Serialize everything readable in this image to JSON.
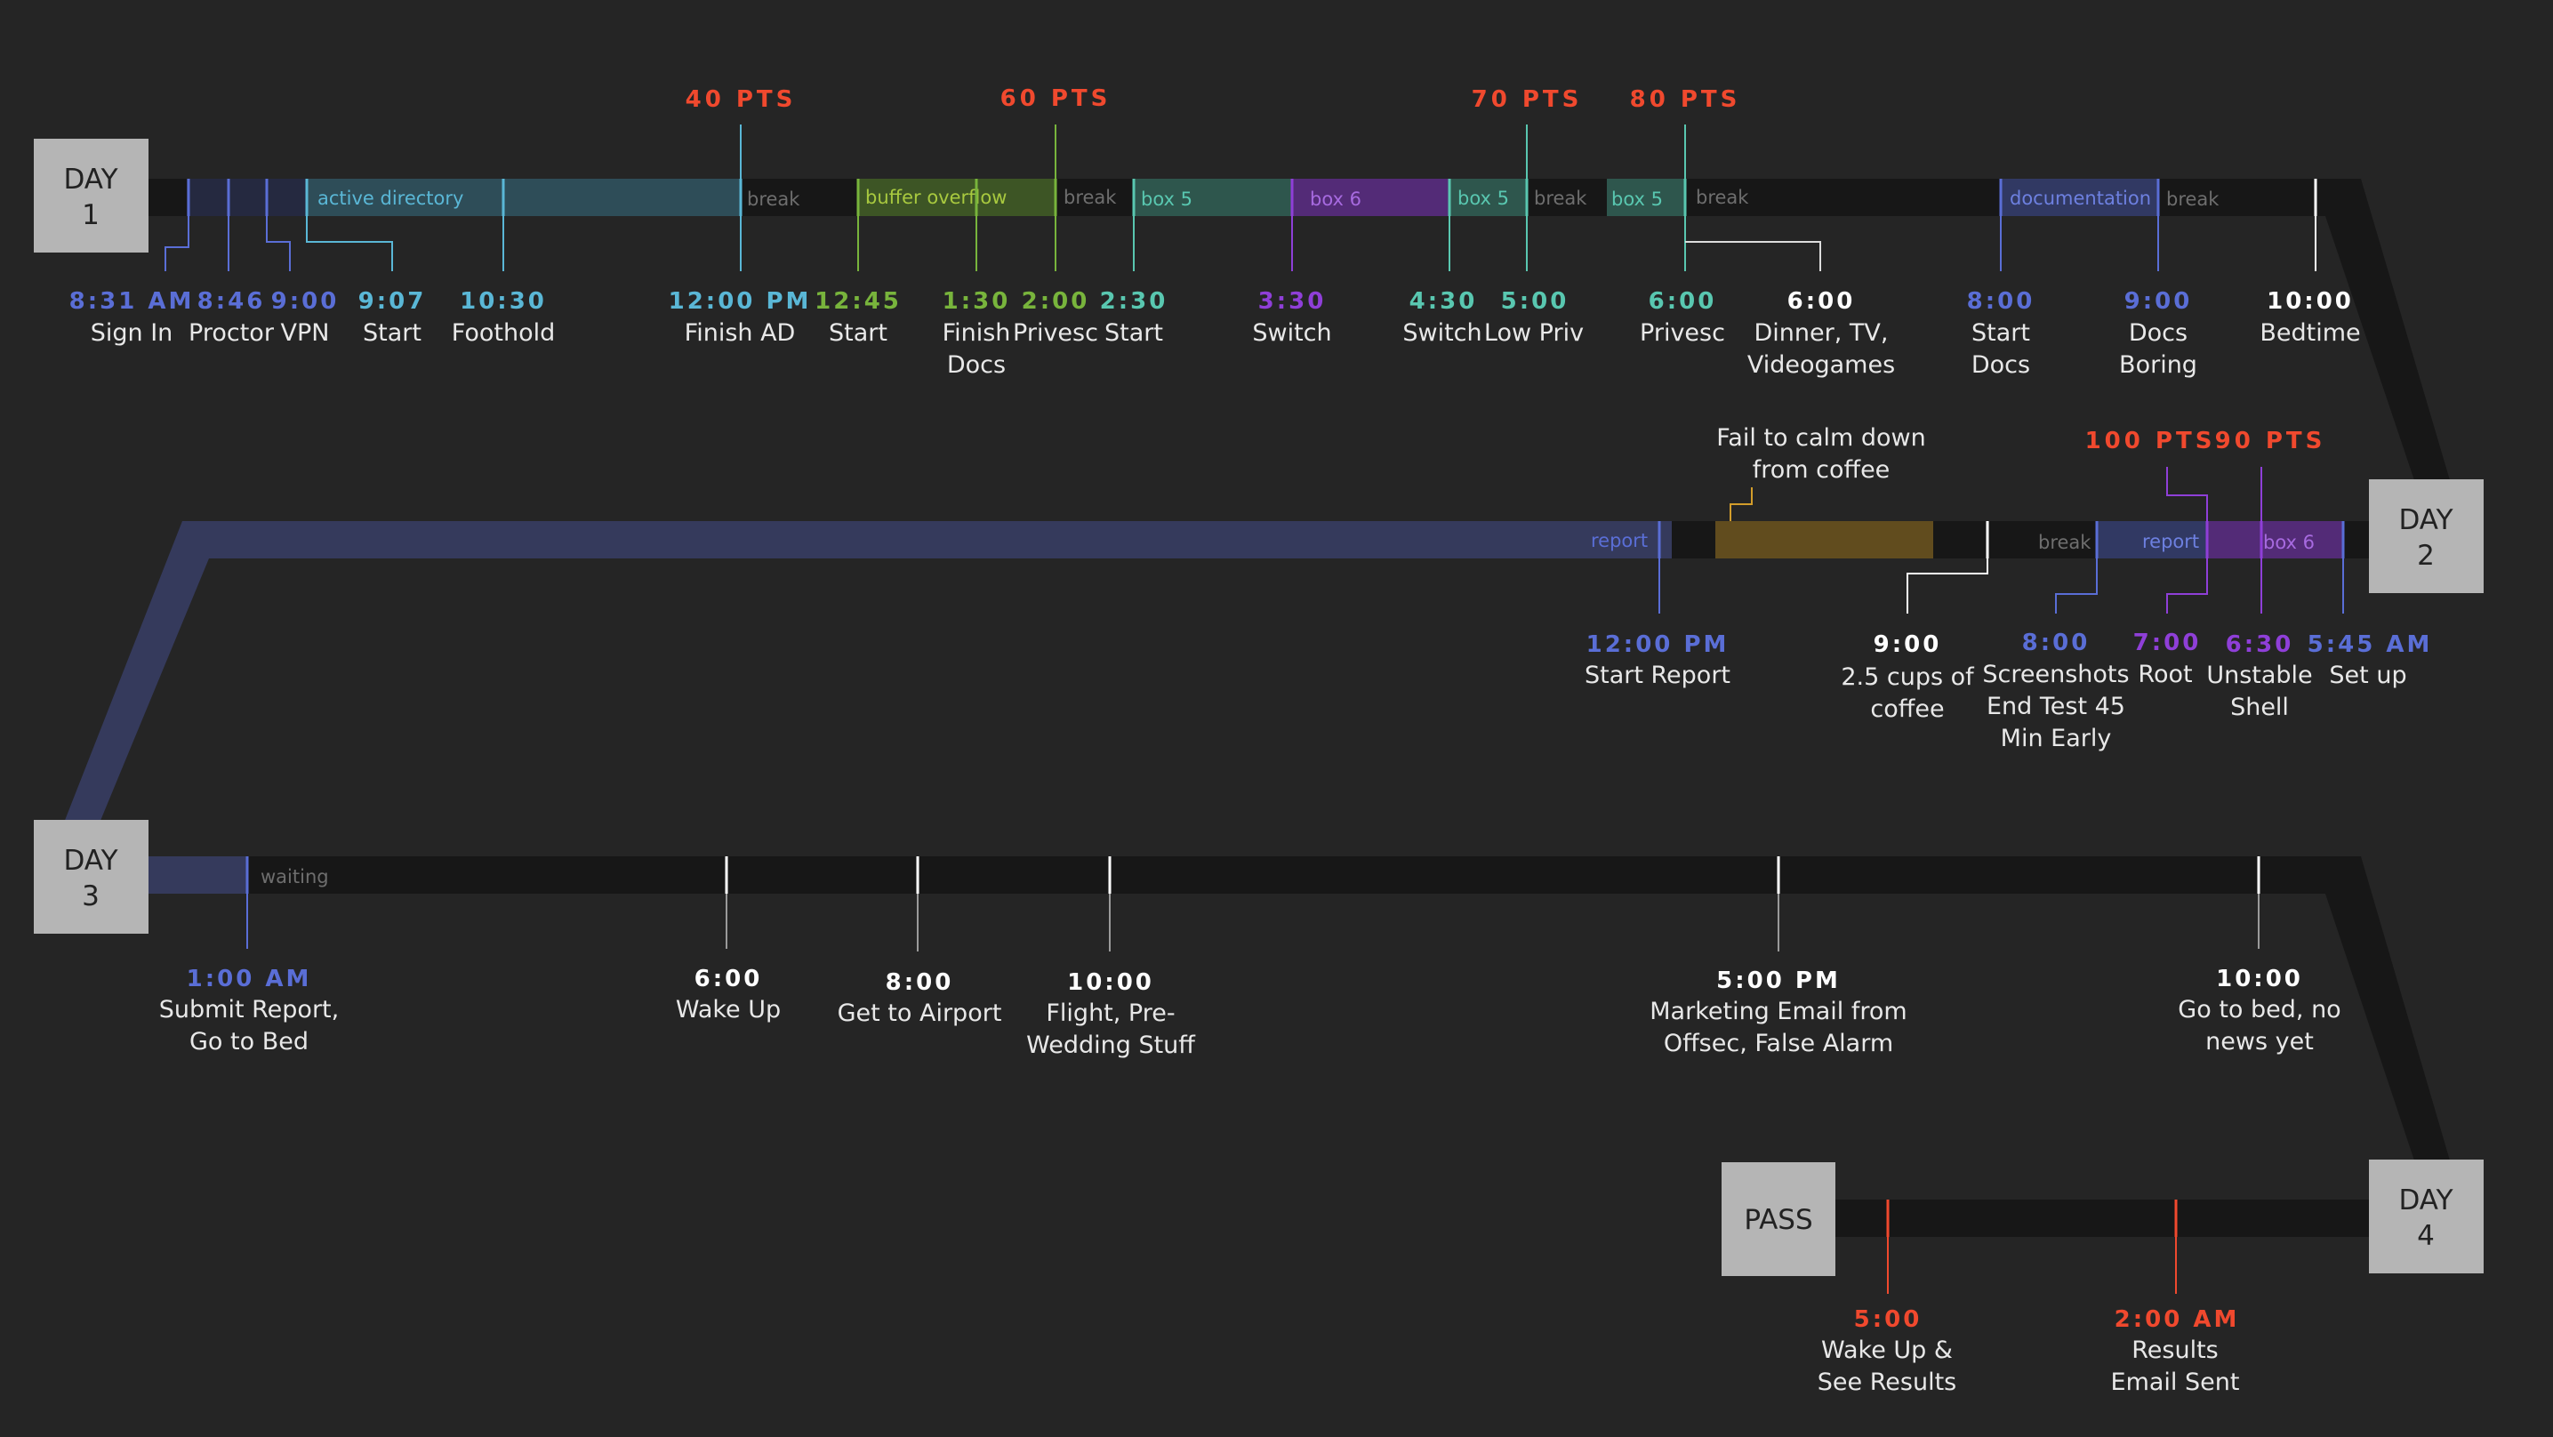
{
  "colors": {
    "background": "#252525",
    "track": "#171717",
    "day_box": "#b5b5b5",
    "cyan": "#5ab7d6",
    "blue": "#5a6ed6",
    "green": "#78b43c",
    "teal": "#59c7b0",
    "purple": "#8f3fd8",
    "red": "#f0492e",
    "white": "#ffffff",
    "gold": "#d39d2b",
    "gray_text": "#6e6e6e"
  },
  "days": [
    {
      "id": "d1",
      "line1": "DAY",
      "line2": "1"
    },
    {
      "id": "d2",
      "line1": "DAY",
      "line2": "2"
    },
    {
      "id": "d3",
      "line1": "DAY",
      "line2": "3"
    },
    {
      "id": "d4",
      "line1": "DAY",
      "line2": "4"
    }
  ],
  "pass_label": "PASS",
  "segments": [
    {
      "id": "s1",
      "label": "active directory",
      "color": "cyan"
    },
    {
      "id": "s2",
      "label": "break",
      "color": "gray"
    },
    {
      "id": "s3",
      "label": "buffer overflow",
      "color": "green"
    },
    {
      "id": "s4",
      "label": "break",
      "color": "gray"
    },
    {
      "id": "s5",
      "label": "box 5",
      "color": "teal"
    },
    {
      "id": "s6",
      "label": "box 6",
      "color": "purple"
    },
    {
      "id": "s7",
      "label": "box 5",
      "color": "teal"
    },
    {
      "id": "s8",
      "label": "break",
      "color": "gray"
    },
    {
      "id": "s9",
      "label": "box 5",
      "color": "teal"
    },
    {
      "id": "s10",
      "label": "break",
      "color": "gray"
    },
    {
      "id": "s11",
      "label": "documentation",
      "color": "blue"
    },
    {
      "id": "s12",
      "label": "break",
      "color": "gray"
    },
    {
      "id": "s13",
      "label": "report",
      "color": "blue"
    },
    {
      "id": "s14",
      "label": "break",
      "color": "gray"
    },
    {
      "id": "s15",
      "label": "report",
      "color": "blue"
    },
    {
      "id": "s16",
      "label": "box 6",
      "color": "purple"
    },
    {
      "id": "s17",
      "label": "waiting",
      "color": "gray"
    }
  ],
  "points": [
    {
      "id": "p1",
      "label": "40 PTS"
    },
    {
      "id": "p2",
      "label": "60 PTS"
    },
    {
      "id": "p3",
      "label": "70 PTS"
    },
    {
      "id": "p4",
      "label": "80 PTS"
    },
    {
      "id": "p5",
      "label": "100 PTS"
    },
    {
      "id": "p6",
      "label": "90 PTS"
    }
  ],
  "events": [
    {
      "id": "e1",
      "time": "8:31 AM",
      "label": [
        "Sign In"
      ],
      "color": "blue"
    },
    {
      "id": "e2",
      "time": "8:46",
      "label": [
        "Proctor"
      ],
      "color": "blue"
    },
    {
      "id": "e3",
      "time": "9:00",
      "label": [
        "VPN"
      ],
      "color": "blue"
    },
    {
      "id": "e4",
      "time": "9:07",
      "label": [
        "Start"
      ],
      "color": "cyan"
    },
    {
      "id": "e5",
      "time": "10:30",
      "label": [
        "Foothold"
      ],
      "color": "cyan"
    },
    {
      "id": "e6",
      "time": "12:00 PM",
      "label": [
        "Finish AD"
      ],
      "color": "cyan"
    },
    {
      "id": "e7",
      "time": "12:45",
      "label": [
        "Start"
      ],
      "color": "green"
    },
    {
      "id": "e8",
      "time": "1:30",
      "label": [
        "Finish",
        "Docs"
      ],
      "color": "green"
    },
    {
      "id": "e9",
      "time": "2:00",
      "label": [
        "Privesc"
      ],
      "color": "green"
    },
    {
      "id": "e10",
      "time": "2:30",
      "label": [
        "Start"
      ],
      "color": "teal"
    },
    {
      "id": "e11",
      "time": "3:30",
      "label": [
        "Switch"
      ],
      "color": "purple"
    },
    {
      "id": "e12",
      "time": "4:30",
      "label": [
        "Switch"
      ],
      "color": "teal"
    },
    {
      "id": "e13",
      "time": "5:00",
      "label": [
        "Low Priv"
      ],
      "color": "teal"
    },
    {
      "id": "e14",
      "time": "6:00",
      "label": [
        "Privesc"
      ],
      "color": "teal"
    },
    {
      "id": "e15",
      "time": "6:00",
      "label": [
        "Dinner, TV,",
        "Videogames"
      ],
      "color": "white"
    },
    {
      "id": "e16",
      "time": "8:00",
      "label": [
        "Start",
        "Docs"
      ],
      "color": "blue"
    },
    {
      "id": "e17",
      "time": "9:00",
      "label": [
        "Docs",
        "Boring"
      ],
      "color": "blue"
    },
    {
      "id": "e18",
      "time": "10:00",
      "label": [
        "Bedtime"
      ],
      "color": "white"
    },
    {
      "id": "e19",
      "time": "12:00 PM",
      "label": [
        "Start Report"
      ],
      "color": "blue"
    },
    {
      "id": "e20",
      "time": "9:00",
      "label": [
        "2.5 cups of",
        "coffee"
      ],
      "color": "white"
    },
    {
      "id": "e21",
      "time": "8:00",
      "label": [
        "Screenshots",
        "End Test 45",
        "Min Early"
      ],
      "color": "blue"
    },
    {
      "id": "e22",
      "time": "7:00",
      "label": [
        "Root"
      ],
      "color": "purple"
    },
    {
      "id": "e23",
      "time": "6:30",
      "label": [
        "Unstable",
        "Shell"
      ],
      "color": "purple"
    },
    {
      "id": "e24",
      "time": "5:45 AM",
      "label": [
        "Set up"
      ],
      "color": "blue"
    },
    {
      "id": "e25",
      "time": "1:00 AM",
      "label": [
        "Submit Report,",
        "Go to Bed"
      ],
      "color": "blue"
    },
    {
      "id": "e26",
      "time": "6:00",
      "label": [
        "Wake Up"
      ],
      "color": "white"
    },
    {
      "id": "e27",
      "time": "8:00",
      "label": [
        "Get to Airport"
      ],
      "color": "white"
    },
    {
      "id": "e28",
      "time": "10:00",
      "label": [
        "Flight, Pre-",
        "Wedding Stuff"
      ],
      "color": "white"
    },
    {
      "id": "e29",
      "time": "5:00 PM",
      "label": [
        "Marketing Email from",
        "Offsec, False Alarm"
      ],
      "color": "white"
    },
    {
      "id": "e30",
      "time": "10:00",
      "label": [
        "Go to bed, no",
        "news yet"
      ],
      "color": "white"
    },
    {
      "id": "e31",
      "time": "5:00",
      "label": [
        "Wake Up &",
        "See Results"
      ],
      "color": "red"
    },
    {
      "id": "e32",
      "time": "2:00 AM",
      "label": [
        "Results",
        "Email Sent"
      ],
      "color": "red"
    }
  ],
  "annotations": [
    {
      "id": "a1",
      "label": [
        "Fail to calm down",
        "from coffee"
      ],
      "color": "gold"
    }
  ]
}
